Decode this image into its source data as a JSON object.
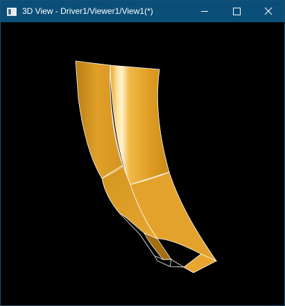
{
  "window": {
    "title": "3D View - Driver1/Viewer1/View1(*)",
    "app_icon": "window-icon",
    "controls": {
      "minimize": "minimize-icon",
      "maximize": "maximize-icon",
      "close": "close-icon"
    },
    "colors": {
      "titlebar": "#0b4f79",
      "title_text": "#ffffff",
      "viewport_background": "#000000"
    }
  },
  "viewport": {
    "model": {
      "shape": "curved horn surface",
      "surface_color": "#e6a322",
      "highlight_color": "#fff1c6",
      "shadow_color": "#8a5d0a",
      "edge_color": "#ffffff"
    }
  }
}
